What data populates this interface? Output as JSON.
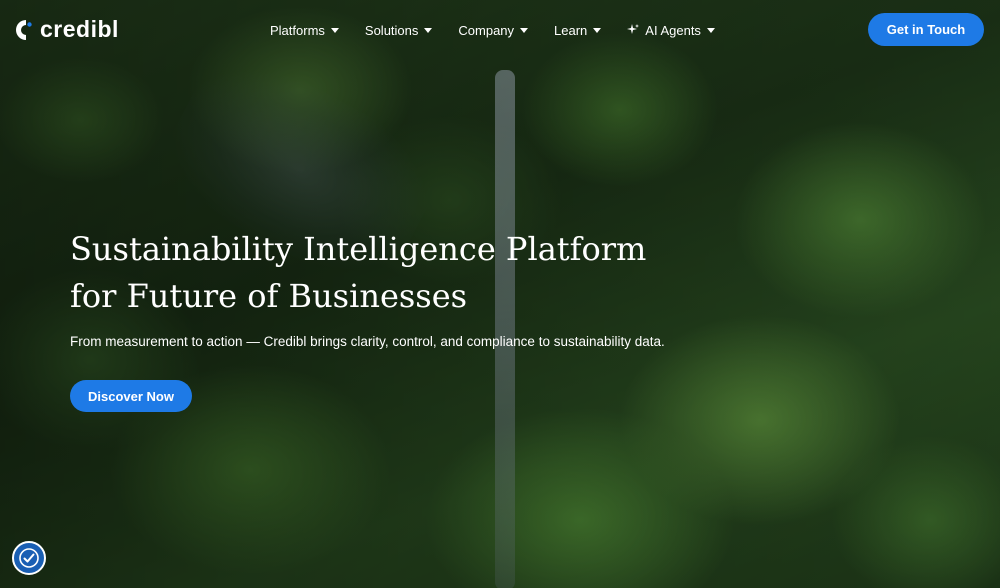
{
  "brand": {
    "name": "credibl",
    "accent": "#1e7ae6"
  },
  "nav": {
    "items": [
      {
        "label": "Platforms",
        "icon": "chevron-down-icon"
      },
      {
        "label": "Solutions",
        "icon": "chevron-down-icon"
      },
      {
        "label": "Company",
        "icon": "chevron-down-icon"
      },
      {
        "label": "Learn",
        "icon": "chevron-down-icon"
      },
      {
        "label": "AI Agents",
        "icon": "chevron-down-icon",
        "leading_icon": "sparkle-icon"
      }
    ],
    "cta_label": "Get in Touch"
  },
  "hero": {
    "headline_line1": "Sustainability Intelligence Platform",
    "headline_line2": "for Future of Businesses",
    "subtext": "From measurement to action — Credibl brings clarity, control, and compliance to sustainability data.",
    "cta_label": "Discover Now",
    "background": "aerial-forest-image"
  },
  "widgets": {
    "accessibility_icon": "accessibility-icon"
  }
}
